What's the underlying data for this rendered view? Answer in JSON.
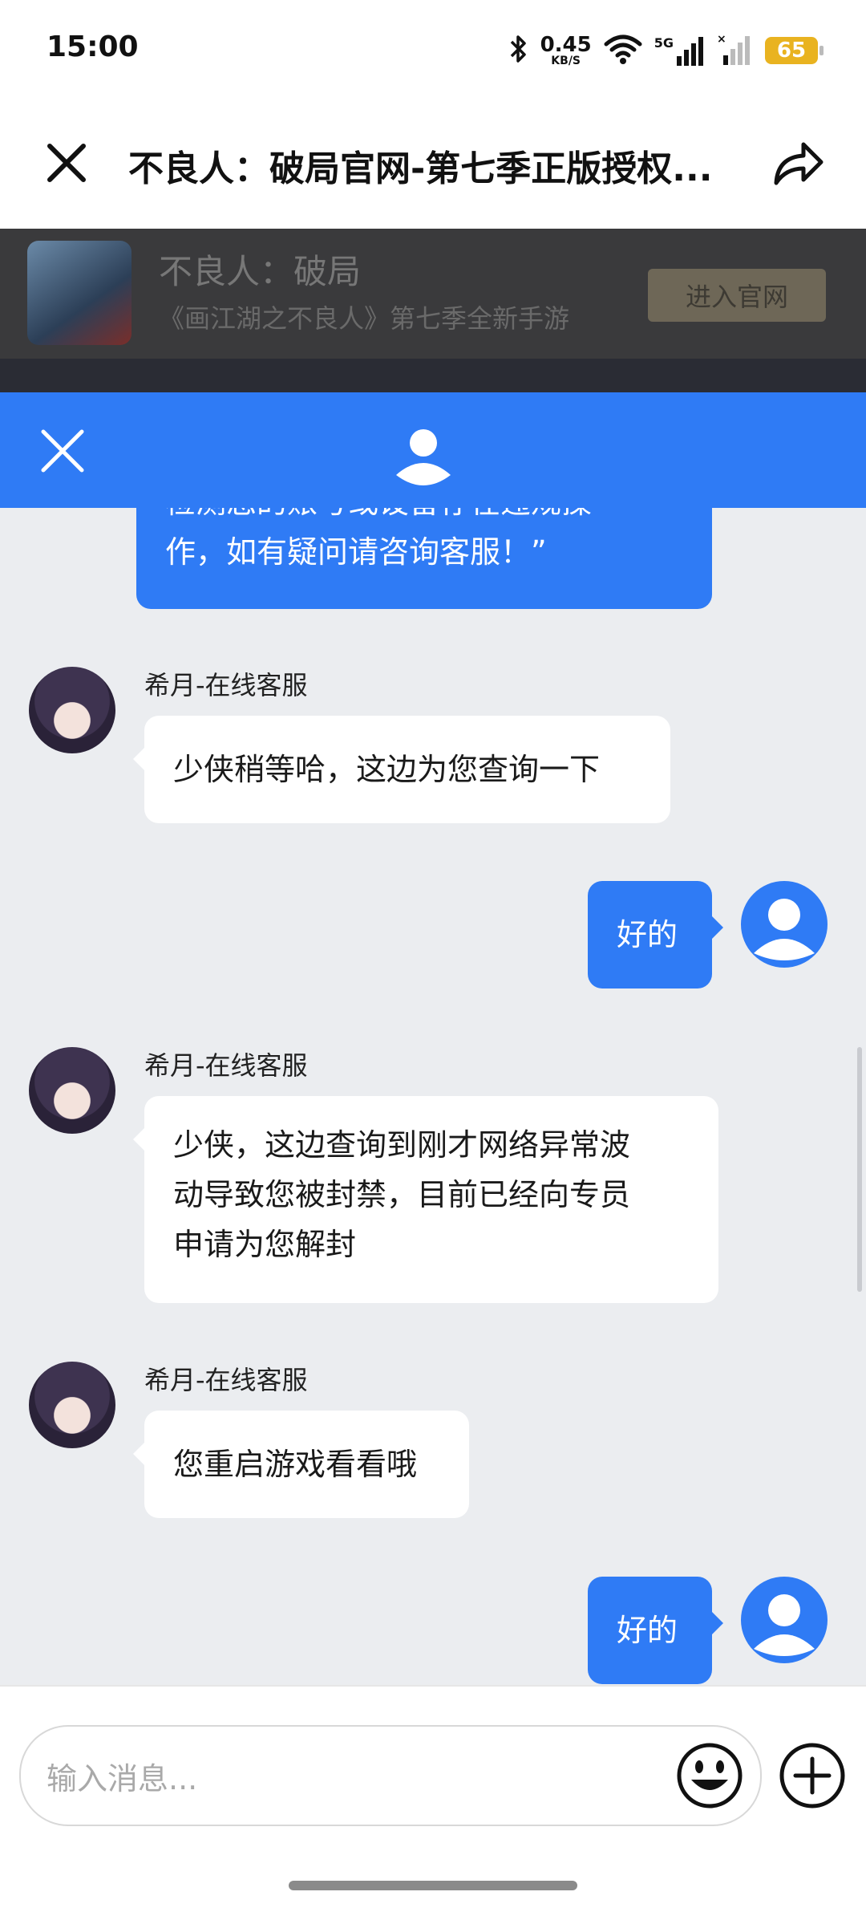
{
  "status_bar": {
    "time": "15:00",
    "net_speed_value": "0.45",
    "net_speed_unit": "KB/S",
    "network_type": "5G",
    "battery": "65"
  },
  "title_bar": {
    "title": "不良人：破局官网-第七季正版授权..."
  },
  "promo_banner": {
    "title": "不良人：破局",
    "subtitle": "《画江湖之不良人》第七季全新手游",
    "button_label": "进入官网"
  },
  "chat": {
    "partial_message_line1": "检测您的账号或设备存在违规操",
    "partial_message_line2": "作，如有疑问请咨询客服！”",
    "messages": [
      {
        "sender": "希月-在线客服",
        "lines": [
          "少侠稍等哈，这边为您查询一下"
        ]
      },
      {
        "sender": "user",
        "lines": [
          "好的"
        ]
      },
      {
        "sender": "希月-在线客服",
        "lines": [
          "少侠，这边查询到刚才网络异常波",
          "动导致您被封禁，目前已经向专员",
          "申请为您解封"
        ]
      },
      {
        "sender": "希月-在线客服",
        "lines": [
          "您重启游戏看看哦"
        ]
      },
      {
        "sender": "user",
        "lines": [
          "好的"
        ]
      }
    ]
  },
  "input": {
    "placeholder": "输入消息..."
  },
  "colors": {
    "accent": "#2f7bf5",
    "chat_background": "#ebedf0"
  }
}
